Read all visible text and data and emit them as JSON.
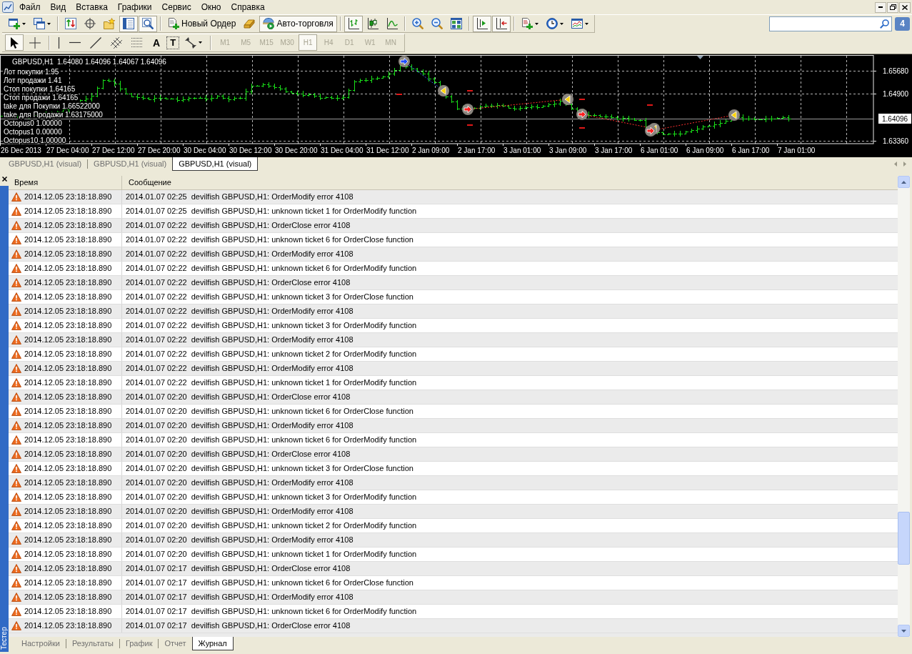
{
  "menu": [
    "Файл",
    "Вид",
    "Вставка",
    "Графики",
    "Сервис",
    "Окно",
    "Справка"
  ],
  "toolbar": {
    "groups": [
      [
        {
          "on": false
        },
        {
          "on": false
        }
      ],
      [
        {
          "on": false
        },
        {
          "on": false
        },
        {
          "on": false
        },
        {
          "on": true
        },
        {
          "on": true
        }
      ],
      [
        {
          "label": "Новый Ордер",
          "on": false
        },
        {
          "on": false
        },
        {
          "label": "Авто-торговля",
          "on": true
        }
      ],
      [
        {
          "on": true
        },
        {
          "on": false
        },
        {
          "on": false
        }
      ],
      [
        {
          "on": false
        },
        {
          "on": false
        },
        {
          "on": false
        }
      ],
      [
        {
          "on": true
        },
        {
          "on": true
        }
      ],
      [
        {
          "on": false
        },
        {
          "on": false
        },
        {
          "on": false
        }
      ]
    ]
  },
  "notifications": {
    "count": "4"
  },
  "drawing_tools": {
    "groups": [
      [
        {
          "on": true
        },
        {
          "on": false
        }
      ],
      [
        {
          "on": false
        },
        {
          "on": false
        },
        {
          "on": false
        },
        {
          "on": false
        },
        {
          "on": false
        },
        {
          "glyph": "A",
          "on": false
        },
        {
          "glyph": "T",
          "on": false
        },
        {
          "on": false
        }
      ]
    ]
  },
  "timeframes": [
    {
      "label": "M1",
      "selected": false,
      "disabled": true
    },
    {
      "label": "M5",
      "selected": false,
      "disabled": true
    },
    {
      "label": "M15",
      "selected": false,
      "disabled": true
    },
    {
      "label": "M30",
      "selected": false,
      "disabled": true
    },
    {
      "label": "H1",
      "selected": true,
      "disabled": true
    },
    {
      "label": "H4",
      "selected": false,
      "disabled": true
    },
    {
      "label": "D1",
      "selected": false,
      "disabled": true
    },
    {
      "label": "W1",
      "selected": false,
      "disabled": true
    },
    {
      "label": "MN",
      "selected": false,
      "disabled": true
    }
  ],
  "chart": {
    "symbol": "GBPUSD,H1",
    "quote": "1.64080 1.64096 1.64067 1.64096",
    "comments": [
      "Лот покупки 1.95",
      "Лот продажи 1.41",
      "Стоп покупки 1.64165",
      "Стоп продажи 1.64165",
      "take для Покупки 1.66522000",
      "take для Продажи 1.63175000",
      "Octopus0 1.00000",
      "Octopus1 0.00000",
      "Octopus10 1.00000"
    ],
    "price_labels": [
      "1.65680",
      "1.64900",
      "1.63360"
    ],
    "current_price": "1.64096",
    "time_labels": [
      "26 Dec 2013",
      "27 Dec 04:00",
      "27 Dec 12:00",
      "27 Dec 20:00",
      "30 Dec 04:00",
      "30 Dec 12:00",
      "30 Dec 20:00",
      "31 Dec 04:00",
      "31 Dec 12:00",
      "2 Jan 09:00",
      "2 Jan 17:00",
      "3 Jan 01:00",
      "3 Jan 09:00",
      "3 Jan 17:00",
      "6 Jan 01:00",
      "6 Jan 09:00",
      "6 Jan 17:00",
      "7 Jan 01:00"
    ]
  },
  "chart_tabs": [
    {
      "label": "GBPUSD,H1 (visual)",
      "selected": false
    },
    {
      "label": "GBPUSD,H1 (visual)",
      "selected": false
    },
    {
      "label": "GBPUSD,H1 (visual)",
      "selected": true
    }
  ],
  "tester": {
    "title": "Тестер",
    "columns": [
      "Время",
      "Сообщение"
    ],
    "rows": [
      {
        "time": "2014.12.05 23:18:18.890",
        "message": "2014.01.07 02:25  devilfish GBPUSD,H1: OrderModify error 4108"
      },
      {
        "time": "2014.12.05 23:18:18.890",
        "message": "2014.01.07 02:25  devilfish GBPUSD,H1: unknown ticket 1 for OrderModify function"
      },
      {
        "time": "2014.12.05 23:18:18.890",
        "message": "2014.01.07 02:22  devilfish GBPUSD,H1: OrderClose error 4108"
      },
      {
        "time": "2014.12.05 23:18:18.890",
        "message": "2014.01.07 02:22  devilfish GBPUSD,H1: unknown ticket 6 for OrderClose function"
      },
      {
        "time": "2014.12.05 23:18:18.890",
        "message": "2014.01.07 02:22  devilfish GBPUSD,H1: OrderModify error 4108"
      },
      {
        "time": "2014.12.05 23:18:18.890",
        "message": "2014.01.07 02:22  devilfish GBPUSD,H1: unknown ticket 6 for OrderModify function"
      },
      {
        "time": "2014.12.05 23:18:18.890",
        "message": "2014.01.07 02:22  devilfish GBPUSD,H1: OrderClose error 4108"
      },
      {
        "time": "2014.12.05 23:18:18.890",
        "message": "2014.01.07 02:22  devilfish GBPUSD,H1: unknown ticket 3 for OrderClose function"
      },
      {
        "time": "2014.12.05 23:18:18.890",
        "message": "2014.01.07 02:22  devilfish GBPUSD,H1: OrderModify error 4108"
      },
      {
        "time": "2014.12.05 23:18:18.890",
        "message": "2014.01.07 02:22  devilfish GBPUSD,H1: unknown ticket 3 for OrderModify function"
      },
      {
        "time": "2014.12.05 23:18:18.890",
        "message": "2014.01.07 02:22  devilfish GBPUSD,H1: OrderModify error 4108"
      },
      {
        "time": "2014.12.05 23:18:18.890",
        "message": "2014.01.07 02:22  devilfish GBPUSD,H1: unknown ticket 2 for OrderModify function"
      },
      {
        "time": "2014.12.05 23:18:18.890",
        "message": "2014.01.07 02:22  devilfish GBPUSD,H1: OrderModify error 4108"
      },
      {
        "time": "2014.12.05 23:18:18.890",
        "message": "2014.01.07 02:22  devilfish GBPUSD,H1: unknown ticket 1 for OrderModify function"
      },
      {
        "time": "2014.12.05 23:18:18.890",
        "message": "2014.01.07 02:20  devilfish GBPUSD,H1: OrderClose error 4108"
      },
      {
        "time": "2014.12.05 23:18:18.890",
        "message": "2014.01.07 02:20  devilfish GBPUSD,H1: unknown ticket 6 for OrderClose function"
      },
      {
        "time": "2014.12.05 23:18:18.890",
        "message": "2014.01.07 02:20  devilfish GBPUSD,H1: OrderModify error 4108"
      },
      {
        "time": "2014.12.05 23:18:18.890",
        "message": "2014.01.07 02:20  devilfish GBPUSD,H1: unknown ticket 6 for OrderModify function"
      },
      {
        "time": "2014.12.05 23:18:18.890",
        "message": "2014.01.07 02:20  devilfish GBPUSD,H1: OrderClose error 4108"
      },
      {
        "time": "2014.12.05 23:18:18.890",
        "message": "2014.01.07 02:20  devilfish GBPUSD,H1: unknown ticket 3 for OrderClose function"
      },
      {
        "time": "2014.12.05 23:18:18.890",
        "message": "2014.01.07 02:20  devilfish GBPUSD,H1: OrderModify error 4108"
      },
      {
        "time": "2014.12.05 23:18:18.890",
        "message": "2014.01.07 02:20  devilfish GBPUSD,H1: unknown ticket 3 for OrderModify function"
      },
      {
        "time": "2014.12.05 23:18:18.890",
        "message": "2014.01.07 02:20  devilfish GBPUSD,H1: OrderModify error 4108"
      },
      {
        "time": "2014.12.05 23:18:18.890",
        "message": "2014.01.07 02:20  devilfish GBPUSD,H1: unknown ticket 2 for OrderModify function"
      },
      {
        "time": "2014.12.05 23:18:18.890",
        "message": "2014.01.07 02:20  devilfish GBPUSD,H1: OrderModify error 4108"
      },
      {
        "time": "2014.12.05 23:18:18.890",
        "message": "2014.01.07 02:20  devilfish GBPUSD,H1: unknown ticket 1 for OrderModify function"
      },
      {
        "time": "2014.12.05 23:18:18.890",
        "message": "2014.01.07 02:17  devilfish GBPUSD,H1: OrderClose error 4108"
      },
      {
        "time": "2014.12.05 23:18:18.890",
        "message": "2014.01.07 02:17  devilfish GBPUSD,H1: unknown ticket 6 for OrderClose function"
      },
      {
        "time": "2014.12.05 23:18:18.890",
        "message": "2014.01.07 02:17  devilfish GBPUSD,H1: OrderModify error 4108"
      },
      {
        "time": "2014.12.05 23:18:18.890",
        "message": "2014.01.07 02:17  devilfish GBPUSD,H1: unknown ticket 6 for OrderModify function"
      },
      {
        "time": "2014.12.05 23:18:18.890",
        "message": "2014.01.07 02:17  devilfish GBPUSD,H1: OrderClose error 4108"
      }
    ],
    "tabs": [
      {
        "label": "Настройки",
        "selected": false
      },
      {
        "label": "Результаты",
        "selected": false
      },
      {
        "label": "График",
        "selected": false
      },
      {
        "label": "Отчет",
        "selected": false
      },
      {
        "label": "Журнал",
        "selected": true
      }
    ]
  }
}
